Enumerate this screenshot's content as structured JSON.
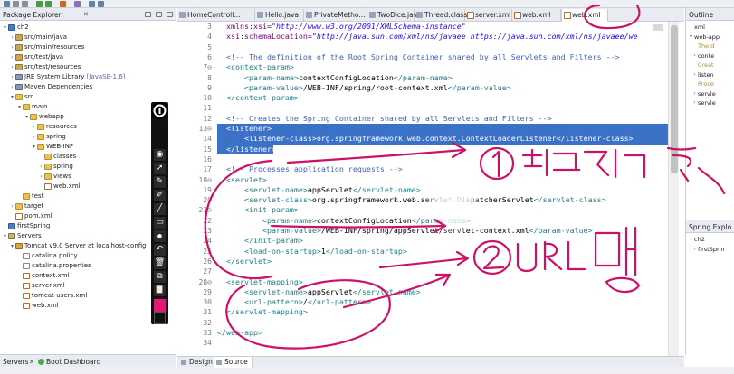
{
  "package_explorer": {
    "title": "Package Explorer",
    "tree": [
      {
        "label": "ch2",
        "icon": "project-icon",
        "indent": 0,
        "twisty": "▾"
      },
      {
        "label": "src/main/java",
        "icon": "package-folder-icon",
        "indent": 1,
        "twisty": "›"
      },
      {
        "label": "src/main/resources",
        "icon": "package-folder-icon",
        "indent": 1,
        "twisty": "›"
      },
      {
        "label": "src/test/java",
        "icon": "package-folder-icon",
        "indent": 1,
        "twisty": "›"
      },
      {
        "label": "src/test/resources",
        "icon": "package-folder-icon",
        "indent": 1,
        "twisty": "›"
      },
      {
        "label": "JRE System Library",
        "deco": "[JavaSE-1.6]",
        "icon": "library-icon",
        "indent": 1,
        "twisty": "›"
      },
      {
        "label": "Maven Dependencies",
        "icon": "library-icon",
        "indent": 1,
        "twisty": "›"
      },
      {
        "label": "src",
        "icon": "folder-icon",
        "indent": 1,
        "twisty": "▾"
      },
      {
        "label": "main",
        "icon": "folder-icon",
        "indent": 2,
        "twisty": "▾"
      },
      {
        "label": "webapp",
        "icon": "folder-icon",
        "indent": 3,
        "twisty": "▾"
      },
      {
        "label": "resources",
        "icon": "folder-icon",
        "indent": 4,
        "twisty": "›"
      },
      {
        "label": "spring",
        "icon": "folder-icon",
        "indent": 4,
        "twisty": "›"
      },
      {
        "label": "WEB-INF",
        "icon": "folder-icon",
        "indent": 4,
        "twisty": "▾"
      },
      {
        "label": "classes",
        "icon": "folder-icon",
        "indent": 5,
        "twisty": ""
      },
      {
        "label": "spring",
        "icon": "folder-icon",
        "indent": 5,
        "twisty": "›"
      },
      {
        "label": "views",
        "icon": "folder-icon",
        "indent": 5,
        "twisty": "›"
      },
      {
        "label": "web.xml",
        "icon": "xml-file-icon",
        "indent": 5,
        "twisty": ""
      },
      {
        "label": "test",
        "icon": "folder-icon",
        "indent": 2,
        "twisty": ""
      },
      {
        "label": "target",
        "icon": "folder-icon",
        "indent": 1,
        "twisty": "›"
      },
      {
        "label": "pom.xml",
        "icon": "xml-file-icon",
        "indent": 1,
        "twisty": ""
      },
      {
        "label": "firstSpring",
        "icon": "project-icon",
        "indent": 0,
        "twisty": "›"
      },
      {
        "label": "Servers",
        "icon": "server-folder-icon",
        "indent": 0,
        "twisty": "▾"
      },
      {
        "label": "Tomcat v9.0 Server at localhost-config",
        "icon": "tomcat-icon",
        "indent": 1,
        "twisty": "▾"
      },
      {
        "label": "catalina.policy",
        "icon": "file-icon",
        "indent": 2,
        "twisty": ""
      },
      {
        "label": "catalina.properties",
        "icon": "file-icon",
        "indent": 2,
        "twisty": ""
      },
      {
        "label": "context.xml",
        "icon": "xml-file-icon",
        "indent": 2,
        "twisty": ""
      },
      {
        "label": "server.xml",
        "icon": "xml-file-icon",
        "indent": 2,
        "twisty": ""
      },
      {
        "label": "tomcat-users.xml",
        "icon": "xml-file-icon",
        "indent": 2,
        "twisty": ""
      },
      {
        "label": "web.xml",
        "icon": "xml-file-icon",
        "indent": 2,
        "twisty": ""
      }
    ]
  },
  "bottom_left": {
    "servers_label": "Servers",
    "boot_dashboard_label": "Boot Dashboard"
  },
  "editor_tabs": [
    {
      "label": "HomeControll...",
      "active": false
    },
    {
      "label": "Hello.java",
      "active": false
    },
    {
      "label": "PrivateMetho...",
      "active": false
    },
    {
      "label": "TwoDice.java",
      "active": false
    },
    {
      "label": "Thread.class",
      "active": false
    },
    {
      "label": "server.xml",
      "active": false
    },
    {
      "label": "web.xml",
      "active": false
    },
    {
      "label": "web.xml",
      "active": true
    }
  ],
  "editor": {
    "lines": [
      {
        "n": "3",
        "marker": "",
        "html": "  <span class=\"c-attr\">xmlns:xsi</span>=<span class=\"c-str\">\"http://www.w3.org/2001/XMLSchema-instance\"</span>"
      },
      {
        "n": "4",
        "marker": "",
        "html": "  <span class=\"c-attr\">xsi:schemaLocation</span>=<span class=\"c-str\">\"http://java.sun.com/xml/ns/javaee https://java.sun.com/xml/ns/javaee/we</span>"
      },
      {
        "n": "5",
        "marker": "",
        "html": ""
      },
      {
        "n": "6",
        "marker": "",
        "html": "  <span class=\"c-com\">&lt;!-- The definition of the Root Spring Container shared by all Servlets and Filters --&gt;</span>"
      },
      {
        "n": "7",
        "marker": "⊖",
        "html": "  <span class=\"c-tag\">&lt;context-param&gt;</span>"
      },
      {
        "n": "8",
        "marker": "",
        "html": "      <span class=\"c-tag\">&lt;param-name&gt;</span><span class=\"c-text\">contextConfigLocation</span><span class=\"c-tag\">&lt;/param-name&gt;</span>"
      },
      {
        "n": "9",
        "marker": "",
        "html": "      <span class=\"c-tag\">&lt;param-value&gt;</span><span class=\"c-text\">/WEB-INF/spring/root-context.xml</span><span class=\"c-tag\">&lt;/param-value&gt;</span>"
      },
      {
        "n": "10",
        "marker": "",
        "html": "  <span class=\"c-tag\">&lt;/context-param&gt;</span>"
      },
      {
        "n": "11",
        "marker": "",
        "html": ""
      },
      {
        "n": "12",
        "marker": "",
        "html": "  <span class=\"c-com\">&lt;!-- Creates the Spring Container shared by all Servlets and Filters --&gt;</span>"
      },
      {
        "n": "13",
        "marker": "⊖",
        "sel": true,
        "html": "  <span class=\"c-tag\">&lt;listener&gt;</span>"
      },
      {
        "n": "14",
        "marker": "",
        "sel": true,
        "html": "      <span class=\"c-tag\">&lt;listener-class&gt;</span><span class=\"c-text\">org.springframework.web.context.ContextLoaderListener</span><span class=\"c-tag\">&lt;/listener-class&gt;</span>"
      },
      {
        "n": "15",
        "marker": "",
        "sel": true,
        "selPartial": true,
        "html": "  <span class=\"c-tag\">&lt;/listener&gt;</span>"
      },
      {
        "n": "16",
        "marker": "",
        "html": ""
      },
      {
        "n": "17",
        "marker": "",
        "html": "  <span class=\"c-com\">&lt;!-- Processes application requests --&gt;</span>"
      },
      {
        "n": "18",
        "marker": "⊖",
        "html": "  <span class=\"c-tag\">&lt;servlet&gt;</span>"
      },
      {
        "n": "19",
        "marker": "",
        "html": "      <span class=\"c-tag\">&lt;servlet-name&gt;</span><span class=\"c-text\">appServlet</span><span class=\"c-tag\">&lt;/servlet-name&gt;</span>"
      },
      {
        "n": "20",
        "marker": "",
        "html": "      <span class=\"c-tag\">&lt;servlet-class&gt;</span><span class=\"c-text\">org.springframework.web.servlet.DispatcherServlet</span><span class=\"c-tag\">&lt;/servlet-class&gt;</span>"
      },
      {
        "n": "21",
        "marker": "⊖",
        "html": "      <span class=\"c-tag\">&lt;init-param&gt;</span>"
      },
      {
        "n": "22",
        "marker": "",
        "html": "          <span class=\"c-tag\">&lt;param-name&gt;</span><span class=\"c-text\">contextConfigLocation</span><span class=\"c-tag\">&lt;/param-name&gt;</span>"
      },
      {
        "n": "23",
        "marker": "",
        "html": "          <span class=\"c-tag\">&lt;param-value&gt;</span><span class=\"c-text\">/WEB-INF/spring/appServlet/servlet-context.xml</span><span class=\"c-tag\">&lt;/param-value&gt;</span>"
      },
      {
        "n": "24",
        "marker": "",
        "html": "      <span class=\"c-tag\">&lt;/init-param&gt;</span>"
      },
      {
        "n": "25",
        "marker": "",
        "html": "      <span class=\"c-tag\">&lt;load-on-startup&gt;</span><span class=\"c-text\">1</span><span class=\"c-tag\">&lt;/load-on-startup&gt;</span>"
      },
      {
        "n": "26",
        "marker": "",
        "html": "  <span class=\"c-tag\">&lt;/servlet&gt;</span>"
      },
      {
        "n": "27",
        "marker": "",
        "html": ""
      },
      {
        "n": "28",
        "marker": "⊖",
        "html": "  <span class=\"c-tag\">&lt;servlet-mapping&gt;</span>"
      },
      {
        "n": "29",
        "marker": "",
        "html": "      <span class=\"c-tag\">&lt;servlet-name&gt;</span><span class=\"c-text\">appServlet</span><span class=\"c-tag\">&lt;/servlet-name&gt;</span>"
      },
      {
        "n": "30",
        "marker": "",
        "html": "      <span class=\"c-tag\">&lt;url-pattern&gt;</span><span class=\"c-text\">/</span><span class=\"c-tag\">&lt;/url-pattern&gt;</span>"
      },
      {
        "n": "31",
        "marker": "",
        "html": "  <span class=\"c-tag\">&lt;/servlet-mapping&gt;</span>"
      },
      {
        "n": "32",
        "marker": "",
        "html": ""
      },
      {
        "n": "33",
        "marker": "",
        "html": "<span class=\"c-tag\">&lt;/web-app&gt;</span>"
      },
      {
        "n": "34",
        "marker": "",
        "html": ""
      }
    ],
    "bottom_tabs": [
      {
        "label": "Design",
        "active": false
      },
      {
        "label": "Source",
        "active": true
      }
    ]
  },
  "outline": {
    "title": "Outline",
    "rows": [
      {
        "label": "xml",
        "twisty": ""
      },
      {
        "label": "web-app",
        "twisty": "▾"
      },
      {
        "label": "The d",
        "twisty": "",
        "dim": true
      },
      {
        "label": "conte",
        "twisty": "›"
      },
      {
        "label": "Creat",
        "twisty": "",
        "dim": true
      },
      {
        "label": "listen",
        "twisty": "›"
      },
      {
        "label": "Proce",
        "twisty": "",
        "dim": true
      },
      {
        "label": "servle",
        "twisty": "›"
      },
      {
        "label": "servle",
        "twisty": "›"
      }
    ]
  },
  "spring_explorer": {
    "title": "Spring Explo",
    "rows": [
      {
        "label": "ch2",
        "twisty": "›"
      },
      {
        "label": "firstSprin",
        "twisty": "›"
      }
    ]
  },
  "annotations": {
    "circle_1_text": "①",
    "label_1_korean": "리스너 등록",
    "circle_2_text": "②",
    "label_2": "URL 매핑"
  },
  "colors": {
    "annotation_pen": "#cc1166",
    "selection": "#3b72c8",
    "xml_tag": "#1f7f86",
    "xml_comment": "#3f5fbf"
  }
}
